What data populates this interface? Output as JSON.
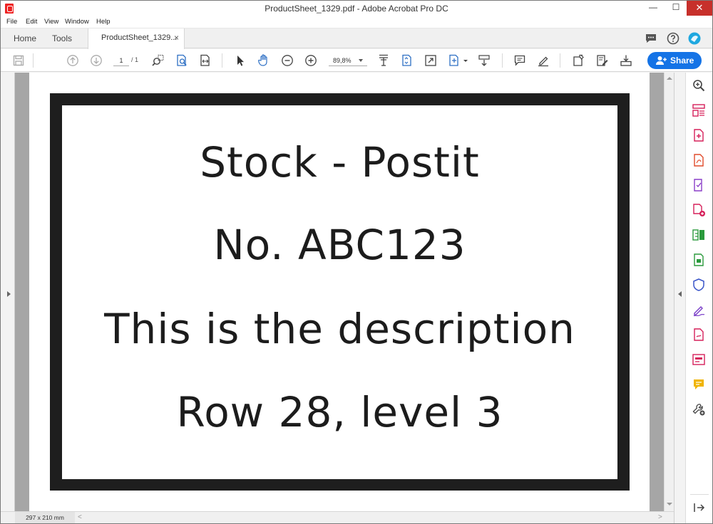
{
  "window": {
    "title": "ProductSheet_1329.pdf - Adobe Acrobat Pro DC",
    "minimize": "—",
    "maximize": "☐",
    "close": "✕"
  },
  "menu": [
    "File",
    "Edit",
    "View",
    "Window",
    "Help"
  ],
  "tabs": {
    "home": "Home",
    "tools": "Tools",
    "document": "ProductSheet_1329...",
    "close": "×"
  },
  "toolbar": {
    "page_current": "1",
    "page_total": "/ 1",
    "zoom": "89,8%",
    "share_label": "Share",
    "share_color": "#1473e6"
  },
  "document": {
    "lines": [
      "Stock - Postit",
      "No. ABC123",
      "This is the description",
      "Row 28, level 3"
    ]
  },
  "status": {
    "page_size": "297 x 210 mm",
    "scroll_left": "<",
    "scroll_right": ">"
  },
  "right_pane_tools": [
    "zoom-tool",
    "organize-pages",
    "create-pdf",
    "export-pdf",
    "edit-pdf",
    "combine-files",
    "compare-files",
    "print-production",
    "protect",
    "fill-sign",
    "send-for-signature",
    "prepare-form",
    "comment",
    "more-tools"
  ]
}
